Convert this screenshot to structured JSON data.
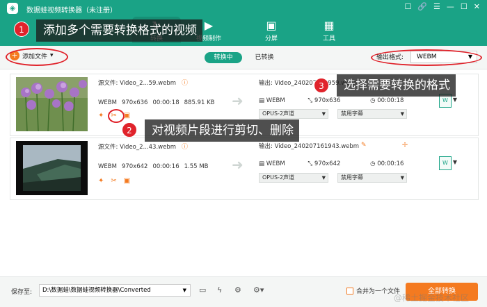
{
  "app": {
    "logo_glyph": "◈",
    "title": "数据蛙视频转换器（未注册）",
    "window_controls": [
      "☐",
      "🔗",
      "☰",
      "—",
      "☐",
      "✕"
    ]
  },
  "nav": [
    {
      "label": "转换",
      "icon": "↻"
    },
    {
      "label": "视频制作",
      "icon": "▶"
    },
    {
      "label": "分屏",
      "icon": "▣"
    },
    {
      "label": "工具",
      "icon": "▦"
    }
  ],
  "toolbar": {
    "add_file": "添加文件",
    "tab_converting": "转换中",
    "tab_converted": "已转换",
    "output_format_label": "输出格式:",
    "output_format_value": "WEBM"
  },
  "files": [
    {
      "source": "源文件: Video_2...59.webm",
      "format": "WEBM",
      "resolution": "970x636",
      "duration": "00:00:18",
      "size": "885.91 KB",
      "output_name": "输出: Video_240207161959.webm",
      "out_format": "WEBM",
      "out_resolution": "970x636",
      "out_duration": "00:00:18",
      "audio": "OPUS-2声道",
      "subtitle": "禁用字幕"
    },
    {
      "source": "源文件: Video_2...43.webm",
      "format": "WEBM",
      "resolution": "970x642",
      "duration": "00:00:16",
      "size": "1.55 MB",
      "output_name": "输出: Video_240207161943.webm",
      "out_format": "WEBM",
      "out_resolution": "970x642",
      "out_duration": "00:00:16",
      "audio": "OPUS-2声道",
      "subtitle": "禁用字幕"
    }
  ],
  "callouts": [
    {
      "num": "1",
      "text": "添加多个需要转换格式的视频"
    },
    {
      "num": "2",
      "text": "对视频片段进行剪切、删除"
    },
    {
      "num": "3",
      "text": "选择需要转换的格式"
    }
  ],
  "bottom": {
    "save_to": "保存至:",
    "path": "D:\\数据蛙\\数据蛙视频转换器\\Converted",
    "merge": "合并为一个文件",
    "convert_all": "全部转换"
  },
  "watermark": "@稀土掘金技术社区",
  "colors": {
    "accent": "#1aa386",
    "orange": "#f47a20",
    "highlight": "#e0232b"
  }
}
